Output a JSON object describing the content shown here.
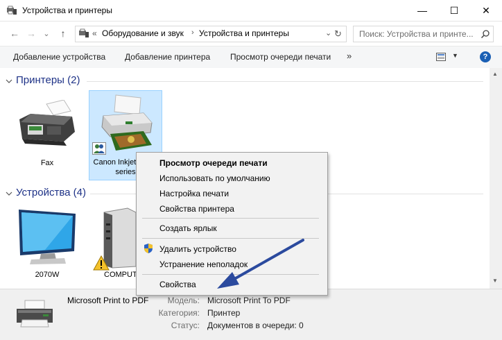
{
  "window": {
    "title": "Устройства и принтеры",
    "minimize_glyph": "—",
    "maximize_glyph": "☐",
    "close_glyph": "✕"
  },
  "nav": {
    "back_glyph": "←",
    "forward_glyph": "→",
    "recent_glyph": "⌄",
    "up_glyph": "↑"
  },
  "address": {
    "overflow": "«",
    "crumbs": [
      "Оборудование и звук",
      "Устройства и принтеры"
    ],
    "separator": "›",
    "refresh_glyph": "↻"
  },
  "search": {
    "placeholder": "Поиск: Устройства и принте..."
  },
  "toolbar": {
    "add_device": "Добавление устройства",
    "add_printer": "Добавление принтера",
    "print_queue": "Просмотр очереди печати",
    "more": "»",
    "view_arrow": "▼",
    "help": "?"
  },
  "groups": {
    "printers": {
      "title": "Принтеры (2)"
    },
    "devices": {
      "title": "Устройства (4)"
    }
  },
  "printers": [
    {
      "label": "Fax"
    },
    {
      "label": "Canon Inkjet iP100 series",
      "selected": true
    }
  ],
  "devices": [
    {
      "label": "2070W"
    },
    {
      "label": "COMPUTER",
      "warning": true
    }
  ],
  "context_menu": {
    "items": [
      {
        "label": "Просмотр очереди печати",
        "bold": true
      },
      {
        "label": "Использовать по умолчанию"
      },
      {
        "label": "Настройка печати"
      },
      {
        "label": "Свойства принтера"
      },
      {
        "separator": true
      },
      {
        "label": "Создать ярлык"
      },
      {
        "separator": true
      },
      {
        "label": "Удалить устройство",
        "icon": "shield-icon"
      },
      {
        "label": "Устранение неполадок"
      },
      {
        "separator": true
      },
      {
        "label": "Свойства"
      }
    ]
  },
  "details": {
    "name": "Microsoft Print to PDF",
    "model_label": "Модель:",
    "model_value": "Microsoft Print To PDF",
    "category_label": "Категория:",
    "category_value": "Принтер",
    "status_label": "Статус:",
    "status_value": "Документов в очереди: 0"
  },
  "scrollbar": {
    "up_glyph": "▲",
    "down_glyph": "▼"
  },
  "colors": {
    "group_header": "#1e3287",
    "selection_bg": "#cce8ff",
    "selection_border": "#99d1ff",
    "arrow": "#2b4a9e"
  }
}
